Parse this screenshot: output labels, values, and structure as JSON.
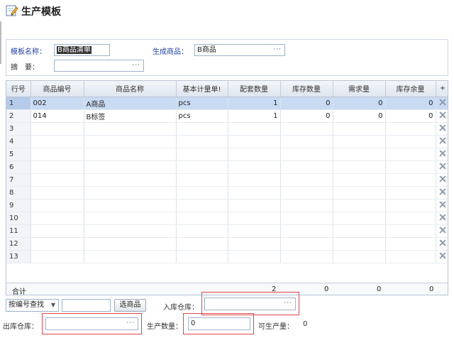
{
  "page": {
    "title": "生产模板"
  },
  "form": {
    "template_name_label": "模板名称：",
    "template_name_value": "B商品清单",
    "product_label": "生成商品：",
    "product_value": "B商品",
    "summary_label": "摘　要：",
    "summary_value": ""
  },
  "grid": {
    "headers": [
      "行号",
      "商品编号",
      "商品名称",
      "基本计量单!",
      "配套数量",
      "库存数量",
      "需求量",
      "库存余量",
      "+"
    ],
    "rows": [
      {
        "no": "1",
        "code": "002",
        "name": "A商品",
        "unit": "pcs",
        "qty": "1",
        "stock": "0",
        "demand": "0",
        "remain": "0"
      },
      {
        "no": "2",
        "code": "014",
        "name": "B标签",
        "unit": "pcs",
        "qty": "1",
        "stock": "0",
        "demand": "0",
        "remain": "0"
      },
      {
        "no": "3",
        "code": "",
        "name": "",
        "unit": "",
        "qty": "",
        "stock": "",
        "demand": "",
        "remain": ""
      },
      {
        "no": "4",
        "code": "",
        "name": "",
        "unit": "",
        "qty": "",
        "stock": "",
        "demand": "",
        "remain": ""
      },
      {
        "no": "5",
        "code": "",
        "name": "",
        "unit": "",
        "qty": "",
        "stock": "",
        "demand": "",
        "remain": ""
      },
      {
        "no": "6",
        "code": "",
        "name": "",
        "unit": "",
        "qty": "",
        "stock": "",
        "demand": "",
        "remain": ""
      },
      {
        "no": "7",
        "code": "",
        "name": "",
        "unit": "",
        "qty": "",
        "stock": "",
        "demand": "",
        "remain": ""
      },
      {
        "no": "8",
        "code": "",
        "name": "",
        "unit": "",
        "qty": "",
        "stock": "",
        "demand": "",
        "remain": ""
      },
      {
        "no": "9",
        "code": "",
        "name": "",
        "unit": "",
        "qty": "",
        "stock": "",
        "demand": "",
        "remain": ""
      },
      {
        "no": "10",
        "code": "",
        "name": "",
        "unit": "",
        "qty": "",
        "stock": "",
        "demand": "",
        "remain": ""
      },
      {
        "no": "11",
        "code": "",
        "name": "",
        "unit": "",
        "qty": "",
        "stock": "",
        "demand": "",
        "remain": ""
      },
      {
        "no": "12",
        "code": "",
        "name": "",
        "unit": "",
        "qty": "",
        "stock": "",
        "demand": "",
        "remain": ""
      },
      {
        "no": "13",
        "code": "",
        "name": "",
        "unit": "",
        "qty": "",
        "stock": "",
        "demand": "",
        "remain": ""
      }
    ],
    "totals": {
      "label": "合计",
      "qty": "2",
      "stock": "0",
      "demand": "0",
      "remain": "0"
    }
  },
  "bottom": {
    "search_mode": "按编号查找",
    "search_value": "",
    "select_button": "选商品",
    "in_warehouse_label": "入库仓库：",
    "in_warehouse_value": "",
    "out_warehouse_label": "出库仓库：",
    "out_warehouse_value": "",
    "production_qty_label": "生产数量：",
    "production_qty_value": "0",
    "producible_label": "可生产量：",
    "producible_value": "0"
  },
  "icons": {
    "title": "edit-pencil-icon",
    "row_action": "remove-row-icon",
    "dropdown": "chevron-down-icon",
    "picker": "ellipsis-icon"
  },
  "colors": {
    "label_blue": "#1f3ea8",
    "selected_row": "#c9dbf3",
    "highlight_box": "#e0454a"
  }
}
